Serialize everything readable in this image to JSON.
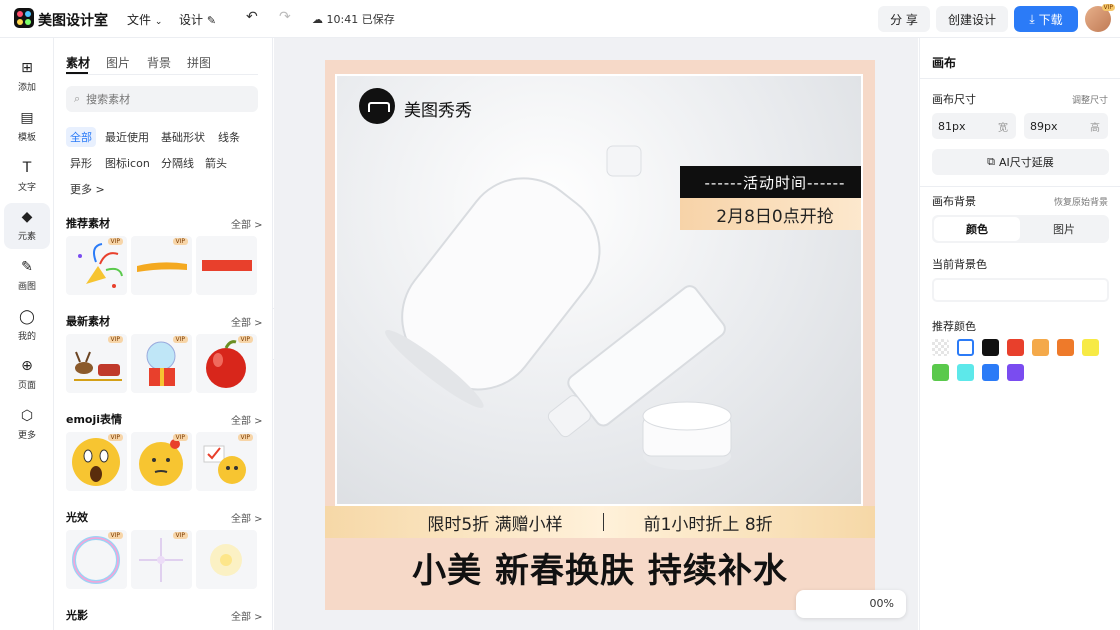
{
  "header": {
    "brand": "美图设计室",
    "menu_file": "文件",
    "menu_design": "设计",
    "save_status": "10:41 已保存",
    "share_label": "分 享",
    "create_label": "创建设计",
    "download_label": "下载",
    "avatar_badge": "VIP"
  },
  "rail": {
    "items": [
      {
        "label": "添加",
        "icon": "plus-square-icon"
      },
      {
        "label": "模板",
        "icon": "template-icon"
      },
      {
        "label": "文字",
        "icon": "text-icon"
      },
      {
        "label": "元素",
        "icon": "element-icon"
      },
      {
        "label": "画图",
        "icon": "draw-icon"
      },
      {
        "label": "我的",
        "icon": "user-icon"
      },
      {
        "label": "页面",
        "icon": "page-add-icon"
      },
      {
        "label": "更多",
        "icon": "cube-icon"
      }
    ],
    "active_index": 3
  },
  "panel": {
    "tabs": [
      "素材",
      "图片",
      "背景",
      "拼图"
    ],
    "search_placeholder": "搜索素材",
    "chips": [
      "全部",
      "最近使用",
      "基础形状",
      "线条",
      "异形",
      "图标icon",
      "分隔线",
      "箭头",
      "更多 >"
    ],
    "sections": [
      {
        "title": "推荐素材",
        "more": "全部 >"
      },
      {
        "title": "最新素材",
        "more": "全部 >"
      },
      {
        "title": "emoji表情",
        "more": "全部 >"
      },
      {
        "title": "光效",
        "more": "全部 >"
      },
      {
        "title": "光影",
        "more": "全部 >"
      }
    ],
    "vip_label": "VIP"
  },
  "canvas": {
    "brand": "美图秀秀",
    "event_title": "------活动时间------",
    "event_date": "2月8日0点开抢",
    "promo_left": "限时5折 满赠小样",
    "promo_right": "前1小时折上 8折",
    "headline": "小美 新春换肤 持续补水",
    "zoom": "00%"
  },
  "right": {
    "title": "画布",
    "size_label": "画布尺寸",
    "size_link": "调整尺寸",
    "width_value": "81px",
    "width_unit": "宽",
    "height_value": "89px",
    "height_unit": "高",
    "ai_button": "AI尺寸延展",
    "bg_label": "画布背景",
    "bg_reset": "恢复原始背景",
    "seg_color": "颜色",
    "seg_image": "图片",
    "current_bg_label": "当前背景色",
    "recommend_label": "推荐颜色",
    "swatches": [
      "transparent",
      "#ffffff",
      "#111111",
      "#e8402c",
      "#f4a94a",
      "#ee7a2a",
      "#f7ea45",
      "#5ac94c",
      "#5de8ea",
      "#2b7bf7",
      "#7a4cf0"
    ]
  }
}
